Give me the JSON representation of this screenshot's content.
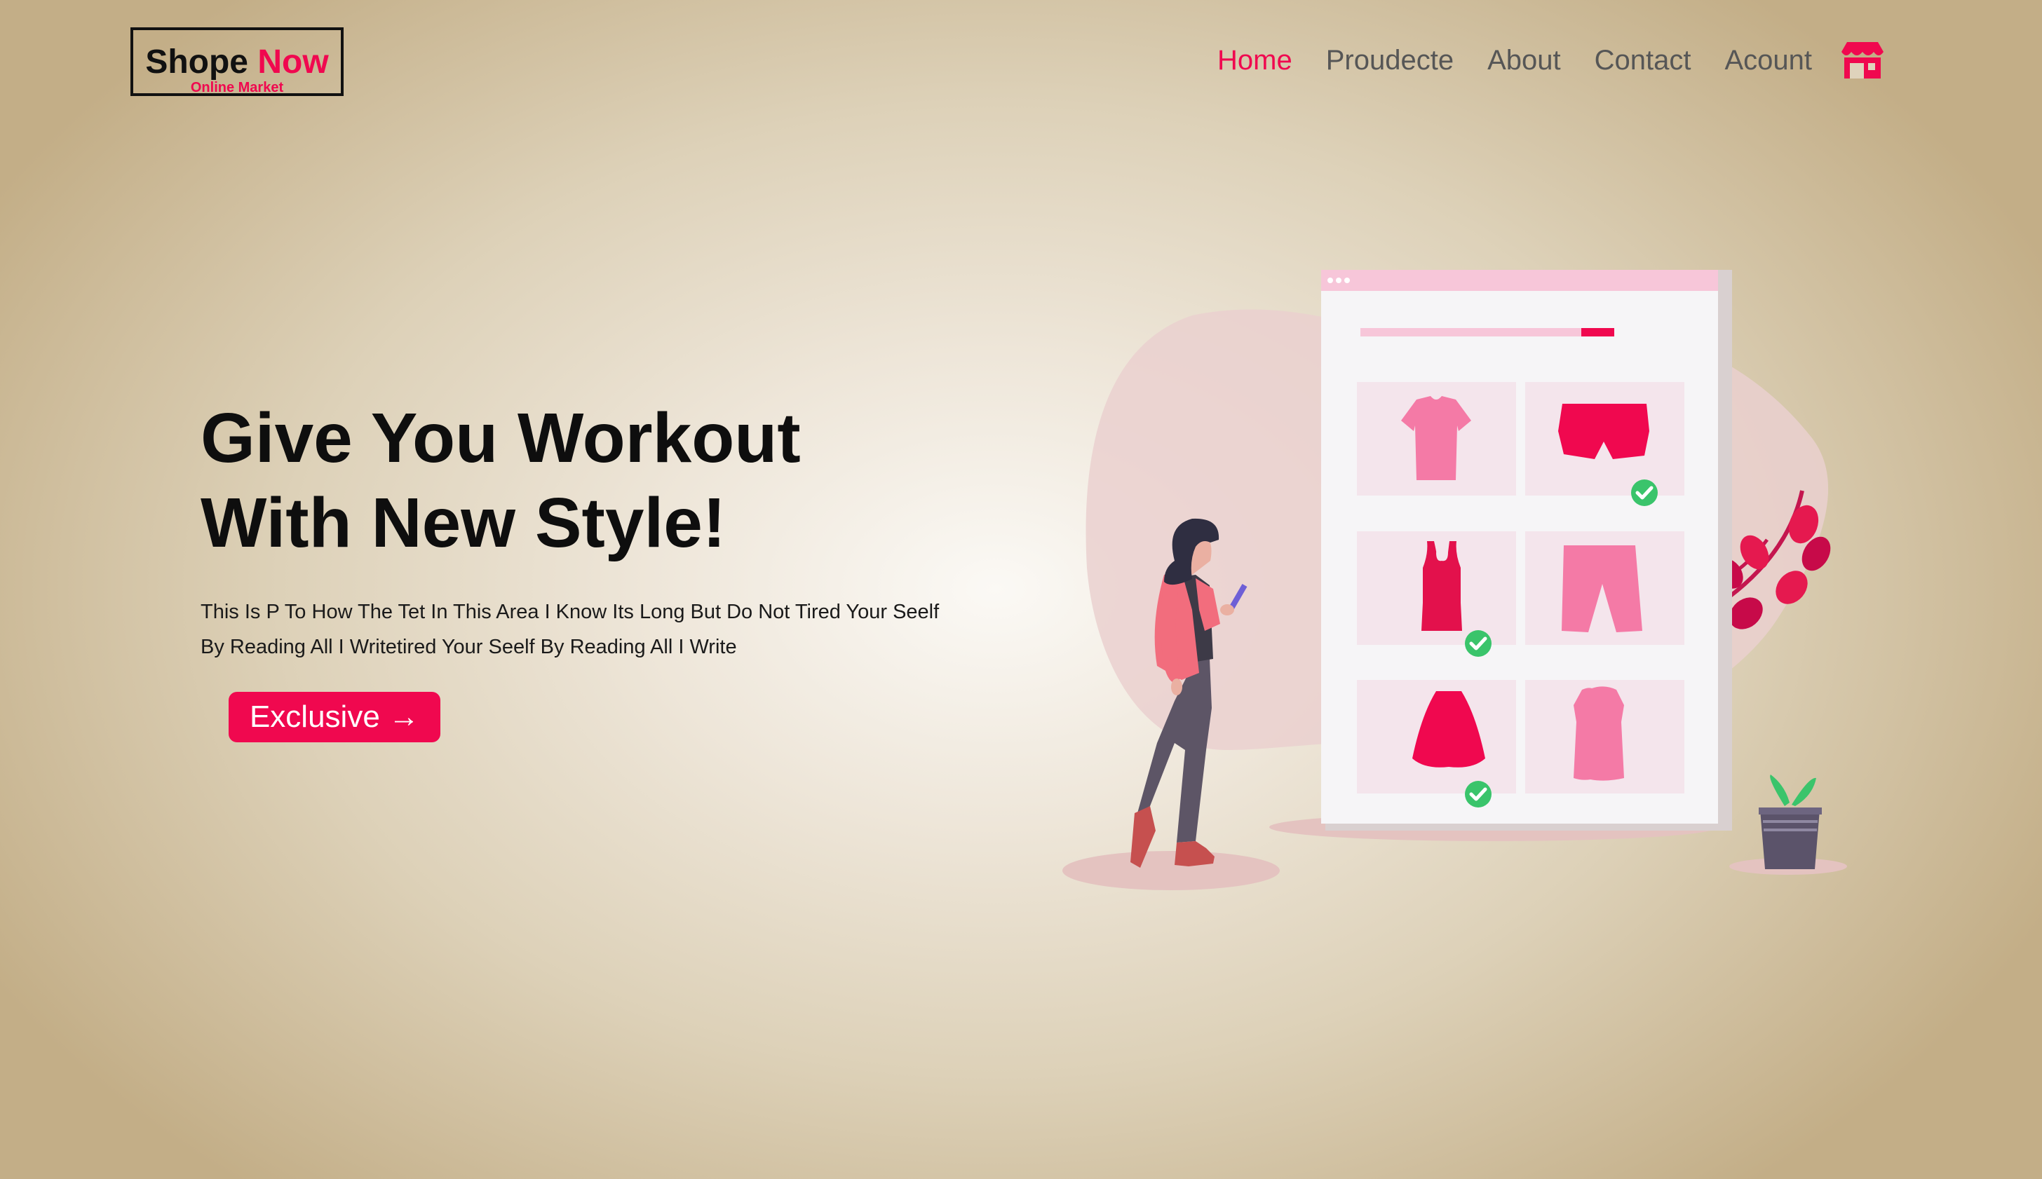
{
  "brand": {
    "name_primary": "Shope",
    "name_accent": "Now",
    "tagline": "Online Market",
    "accent_color": "#f0084f"
  },
  "nav": {
    "items": [
      {
        "label": "Home",
        "active": true
      },
      {
        "label": "Proudecte",
        "active": false
      },
      {
        "label": "About",
        "active": false
      },
      {
        "label": "Contact",
        "active": false
      },
      {
        "label": "Acount",
        "active": false
      }
    ],
    "cart_icon": "store-icon"
  },
  "hero": {
    "title_line1": "Give You Workout",
    "title_line2": "With New Style!",
    "description": "This Is P To How The Tet In This Area I Know Its Long But Do Not Tired Your Seelf By Reading All I Writetired Your Seelf By Reading All I Write",
    "cta_label": "Exclusive →"
  },
  "illustration": {
    "icon": "online-shopping-illustration",
    "product_icons": [
      "t-shirt-icon",
      "shorts-icon",
      "tank-top-icon",
      "shorts-icon",
      "skirt-icon",
      "vest-icon"
    ],
    "checked_items": [
      2,
      3,
      5
    ],
    "check_color": "#3ac46b"
  }
}
